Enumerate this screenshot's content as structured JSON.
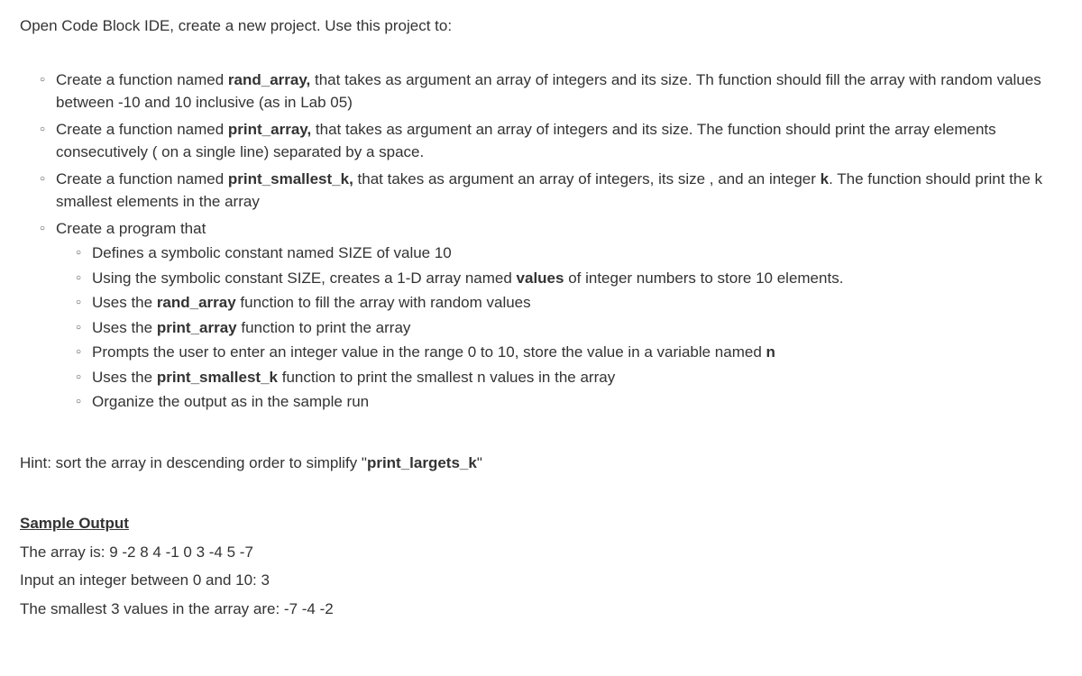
{
  "intro": "Open Code Block IDE, create a new project. Use this project to:",
  "items": [
    {
      "pre": "Create a function named ",
      "bold": "rand_array,",
      "post": " that takes as  argument an array of integers and its size. Th function should fill the array with random values between -10 and  10  inclusive (as in Lab 05)"
    },
    {
      "pre": "Create a function named ",
      "bold": "print_array,",
      "post": " that takes as  argument an array of integers and its size. The function should print the array elements consecutively ( on a single line) separated by a space."
    },
    {
      "pre": "Create a function named ",
      "bold": "print_smallest_k,",
      "post": " that takes as  argument an array of integers, its size , and an integer ",
      "bold2": "k",
      "post2": ". The function should print the k smallest elements in the array"
    },
    {
      "pre": "Create a program that"
    }
  ],
  "subitems": [
    {
      "pre": "Defines a symbolic constant named SIZE of value 10"
    },
    {
      "pre": "Using the symbolic constant SIZE, creates a 1-D array named ",
      "bold": "values",
      "post": " of  integer numbers to store 10 elements."
    },
    {
      "pre": "Uses the ",
      "bold": "rand_array",
      "post": " function to fill the array with random values"
    },
    {
      "pre": "Uses the ",
      "bold": "print_array",
      "post": " function to print the array"
    },
    {
      "pre": "Prompts the user to enter an integer  value in the range 0 to 10, store the value in a variable named ",
      "bold": "n"
    },
    {
      "pre": "Uses the ",
      "bold": "print_smallest_k",
      "post": " function  to print the smallest n values in the array"
    },
    {
      "pre": "Organize the output as in the sample run"
    }
  ],
  "hint": {
    "pre": "Hint: sort the array in descending order to simplify \"",
    "bold": "print_largets_k",
    "post": "\""
  },
  "sample": {
    "heading": "Sample Output",
    "line1": "The array is:  9 -2 8 4 -1 0 3 -4 5 -7",
    "line2": "Input an integer between 0 and 10: 3",
    "line3": "The smallest 3 values in the array are: -7 -4 -2"
  }
}
